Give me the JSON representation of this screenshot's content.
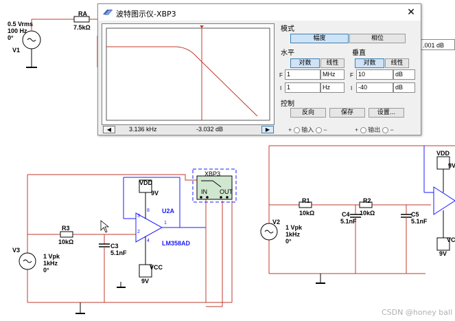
{
  "window": {
    "title": "波特图示仪-XBP3",
    "close_label": "✕"
  },
  "plot": {
    "freq_readout": "3.136 kHz",
    "mag_readout": "-3.032 dB",
    "trace_color": "#c0392b"
  },
  "mode": {
    "title": "模式",
    "magnitude": "幅度",
    "phase": "相位"
  },
  "horizontal": {
    "title": "水平",
    "log": "对数",
    "linear": "线性",
    "f_label": "F",
    "f_value": "1",
    "f_unit": "MHz",
    "i_label": "I",
    "i_value": "1",
    "i_unit": "Hz"
  },
  "vertical": {
    "title": "垂直",
    "log": "对数",
    "linear": "线性",
    "f_label": "F",
    "f_value": "10",
    "f_unit": "dB",
    "i_label": "I",
    "i_value": "-40",
    "i_unit": "dB"
  },
  "control": {
    "title": "控制",
    "reverse": "反向",
    "save": "保存",
    "settings": "设置..."
  },
  "ports": {
    "input_label": "输入",
    "output_label": "输出",
    "plus": "+",
    "minus": "−"
  },
  "schematic": {
    "v1_value": "0.5 Vrms",
    "v1_freq": "100 Hz",
    "v1_phase": "0°",
    "v1_name": "V1",
    "ra_name": "RA",
    "ra_value": "7.5kΩ",
    "remnant_value": ".001 dB",
    "xbp3_name": "XBP3",
    "in_label": "IN",
    "out_label": "OUT",
    "vdd_label": "VDD",
    "vdd_value": "9V",
    "vcc_label": "VCC",
    "vcc_value": "9V",
    "u2a_name": "U2A",
    "u2a_part": "LM358AD",
    "r3_name": "R3",
    "r3_value": "10kΩ",
    "c3_name": "C3",
    "c3_value": "5.1nF",
    "v3_name": "V3",
    "v3_value": "1 Vpk",
    "v3_freq": "1kHz",
    "v3_phase": "0°",
    "pin8": "8",
    "pin3": "3",
    "pin2": "2",
    "pin4": "4",
    "pin1": "1",
    "r1_name": "R1",
    "r1_value": "10kΩ",
    "r2_name": "R2",
    "r2_value": "10kΩ",
    "c4_name": "C4",
    "c4_value": "5.1nF",
    "c5_name": "C5",
    "c5_value": "5.1nF",
    "v2_name": "V2",
    "v2_value": "1 Vpk",
    "v2_freq": "1kHz",
    "v2_phase": "0°",
    "vdd2_label": "VDD",
    "vdd2_value": "9V",
    "vcc2_label": "VC",
    "vcc2_value": "9V"
  },
  "watermark": "CSDN @honey ball",
  "colors": {
    "wire": "#c0392b",
    "part_blue": "#1a1aff",
    "instrument_green": "#cfe6cf"
  }
}
